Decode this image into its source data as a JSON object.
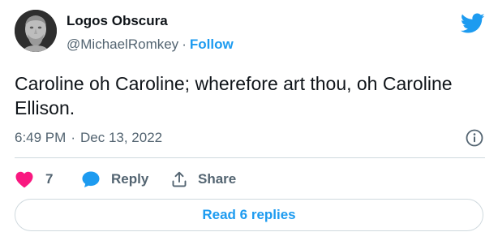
{
  "author": {
    "name": "Logos Obscura",
    "handle": "@MichaelRomkey",
    "separator": "·",
    "follow_label": "Follow"
  },
  "tweet": {
    "text": "Caroline oh Caroline; wherefore art thou, oh Caroline Ellison.",
    "time": "6:49 PM",
    "date_separator": "·",
    "date": "Dec 13, 2022"
  },
  "actions": {
    "like_count": "7",
    "reply_label": "Reply",
    "share_label": "Share"
  },
  "read_replies_label": "Read 6 replies",
  "icons": {
    "avatar": "statue-bust-avatar",
    "brand": "twitter-bird-icon",
    "info": "info-icon",
    "like": "heart-icon",
    "reply": "speech-bubble-icon",
    "share": "share-upload-icon"
  },
  "colors": {
    "accent": "#1d9bf0",
    "like": "#f91880",
    "text": "#0f1419",
    "secondary": "#536471",
    "border": "#cfd9de"
  }
}
